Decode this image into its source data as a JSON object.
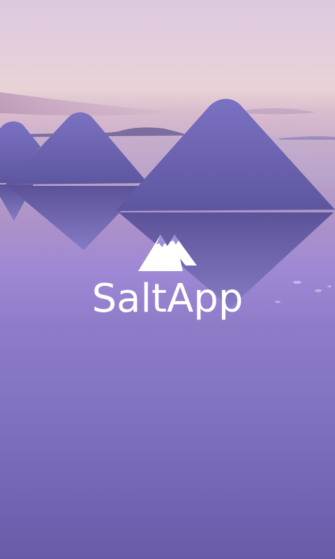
{
  "app": {
    "name": "SaltApp"
  },
  "background": {
    "scene": "salt-flat-pyramids",
    "sky_color": "#e3cfdc",
    "water_color": "#8a7ac8",
    "salt_color": "#6f64b4"
  },
  "logo": {
    "icon": "mountain-icon",
    "color": "#ffffff"
  }
}
